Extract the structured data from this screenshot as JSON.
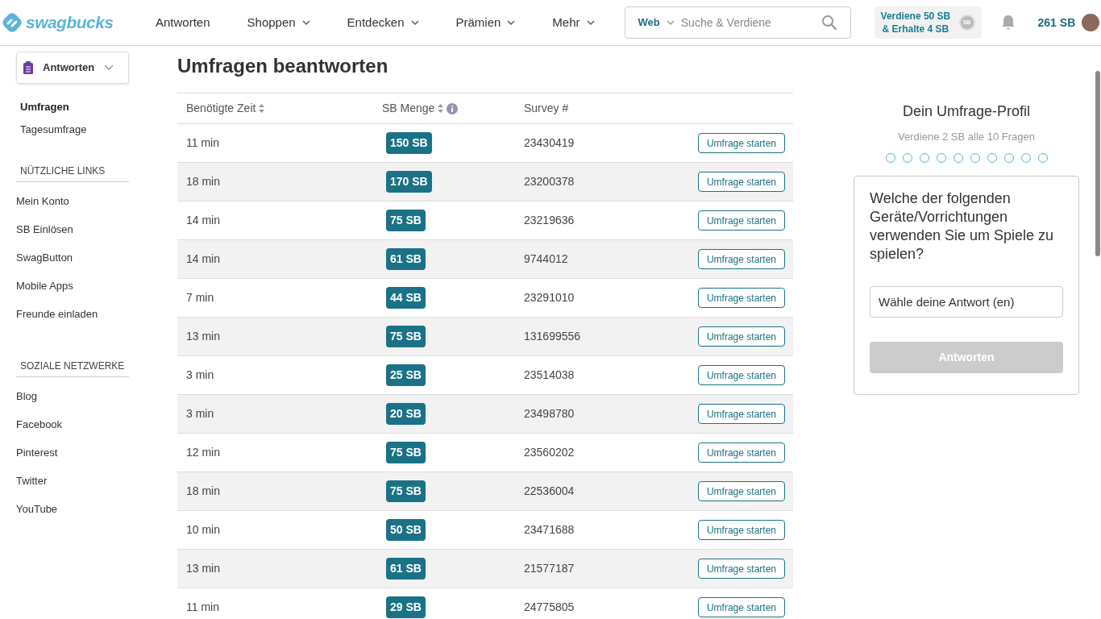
{
  "header": {
    "logo": "swagbucks",
    "nav": [
      {
        "label": "Antworten",
        "dropdown": false
      },
      {
        "label": "Shoppen",
        "dropdown": true
      },
      {
        "label": "Entdecken",
        "dropdown": true
      },
      {
        "label": "Prämien",
        "dropdown": true
      },
      {
        "label": "Mehr",
        "dropdown": true
      }
    ],
    "search": {
      "scope": "Web",
      "placeholder": "Suche & Verdiene"
    },
    "promo": [
      "Verdiene 50 SB",
      "& Erhalte 4 SB"
    ],
    "promo_badge": "SB",
    "balance": "261 SB"
  },
  "sidebar": {
    "dropdown": "Antworten",
    "items": [
      {
        "label": "Umfragen",
        "selected": true
      },
      {
        "label": "Tagesumfrage",
        "selected": false
      }
    ],
    "sections": [
      {
        "title": "NÜTZLICHE LINKS",
        "links": [
          "Mein Konto",
          "SB Einlösen",
          "SwagButton",
          "Mobile Apps",
          "Freunde einladen"
        ]
      },
      {
        "title": "SOZIALE NETZWERKE",
        "links": [
          "Blog",
          "Facebook",
          "Pinterest",
          "Twitter",
          "YouTube"
        ]
      }
    ]
  },
  "main": {
    "title": "Umfragen beantworten",
    "table": {
      "columns": [
        {
          "label": "Benötigte Zeit",
          "sortable": true,
          "info": false
        },
        {
          "label": "SB Menge",
          "sortable": true,
          "info": true
        },
        {
          "label": "Survey #",
          "sortable": false,
          "info": false
        }
      ],
      "rows": [
        {
          "time": "11 min",
          "sb": "150 SB",
          "survey": "23430419",
          "action": "Umfrage starten"
        },
        {
          "time": "18 min",
          "sb": "170 SB",
          "survey": "23200378",
          "action": "Umfrage starten"
        },
        {
          "time": "14 min",
          "sb": "75 SB",
          "survey": "23219636",
          "action": "Umfrage starten"
        },
        {
          "time": "14 min",
          "sb": "61 SB",
          "survey": "9744012",
          "action": "Umfrage starten"
        },
        {
          "time": "7 min",
          "sb": "44 SB",
          "survey": "23291010",
          "action": "Umfrage starten"
        },
        {
          "time": "13 min",
          "sb": "75 SB",
          "survey": "131699556",
          "action": "Umfrage starten"
        },
        {
          "time": "3 min",
          "sb": "25 SB",
          "survey": "23514038",
          "action": "Umfrage starten"
        },
        {
          "time": "3 min",
          "sb": "20 SB",
          "survey": "23498780",
          "action": "Umfrage starten"
        },
        {
          "time": "12 min",
          "sb": "75 SB",
          "survey": "23560202",
          "action": "Umfrage starten"
        },
        {
          "time": "18 min",
          "sb": "75 SB",
          "survey": "22536004",
          "action": "Umfrage starten"
        },
        {
          "time": "10 min",
          "sb": "50 SB",
          "survey": "23471688",
          "action": "Umfrage starten"
        },
        {
          "time": "13 min",
          "sb": "61 SB",
          "survey": "21577187",
          "action": "Umfrage starten"
        },
        {
          "time": "11 min",
          "sb": "29 SB",
          "survey": "24775805",
          "action": "Umfrage starten"
        }
      ]
    }
  },
  "profile": {
    "title": "Dein Umfrage-Profil",
    "subtitle": "Verdiene 2 SB alle 10 Fragen",
    "dots": [
      {
        "filled": false
      },
      {
        "filled": false
      },
      {
        "filled": false
      },
      {
        "filled": false
      },
      {
        "filled": false
      },
      {
        "filled": false
      },
      {
        "filled": false
      },
      {
        "filled": false
      },
      {
        "filled": false
      },
      {
        "filled": false
      }
    ],
    "question": "Welche der folgenden Geräte/Vorrichtungen verwenden Sie um Spiele zu spielen?",
    "answer_placeholder": "Wähle deine Antwort (en)",
    "submit": {
      "label": "Antworten",
      "disabled": true
    }
  }
}
